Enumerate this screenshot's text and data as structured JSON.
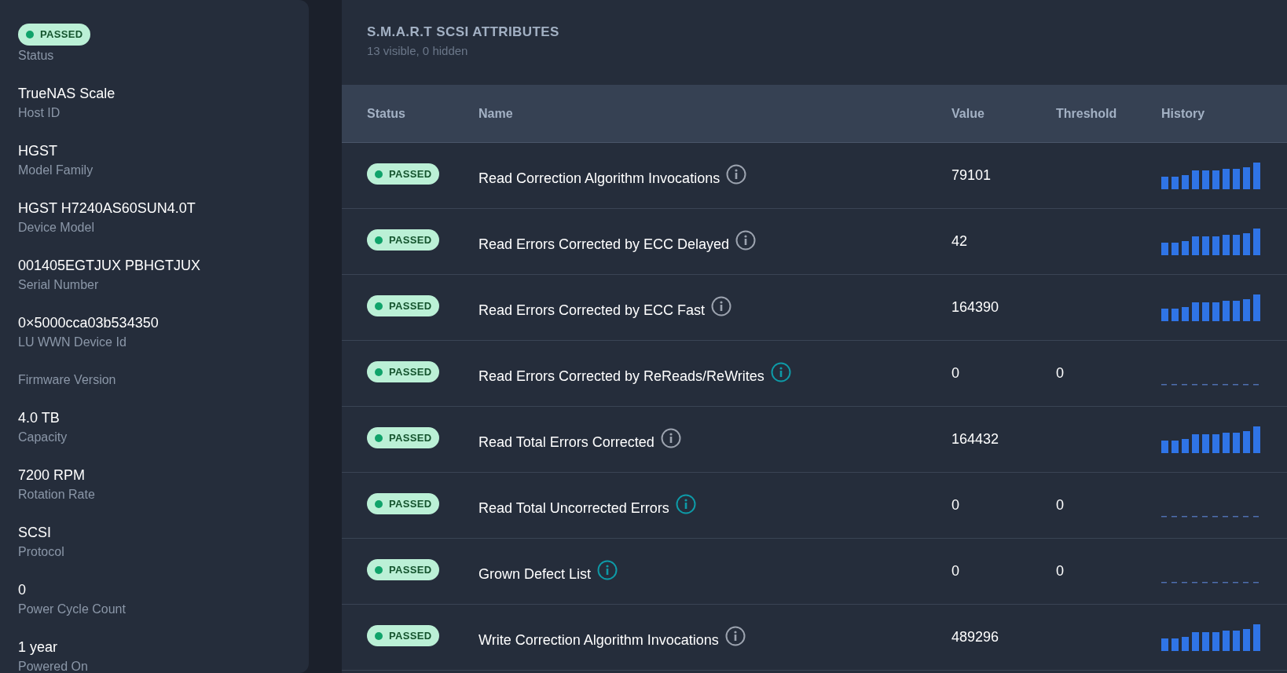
{
  "sidebar": {
    "items": [
      {
        "kind": "badge",
        "value": "PASSED",
        "label": "Status"
      },
      {
        "kind": "text",
        "value": "TrueNAS Scale",
        "label": "Host ID"
      },
      {
        "kind": "text",
        "value": "HGST",
        "label": "Model Family"
      },
      {
        "kind": "text",
        "value": "HGST H7240AS60SUN4.0T",
        "label": "Device Model"
      },
      {
        "kind": "text",
        "value": "001405EGTJUX PBHGTJUX",
        "label": "Serial Number"
      },
      {
        "kind": "text",
        "value": "0×5000cca03b534350",
        "label": "LU WWN Device Id"
      },
      {
        "kind": "text",
        "label": "Firmware Version"
      },
      {
        "kind": "text",
        "value": "4.0 TB",
        "label": "Capacity"
      },
      {
        "kind": "text",
        "value": "7200 RPM",
        "label": "Rotation Rate"
      },
      {
        "kind": "text",
        "value": "SCSI",
        "label": "Protocol"
      },
      {
        "kind": "text",
        "value": "0",
        "label": "Power Cycle Count"
      },
      {
        "kind": "text",
        "value": "1 year",
        "label": "Powered On"
      }
    ]
  },
  "panel": {
    "title": "S.M.A.R.T SCSI ATTRIBUTES",
    "subtitle": "13 visible, 0 hidden"
  },
  "table": {
    "columns": [
      "Status",
      "Name",
      "Value",
      "Threshold",
      "History"
    ],
    "rows": [
      {
        "status": "PASSED",
        "name": "Read Correction Algorithm Invocations",
        "color": "#9ca3af",
        "value": "79101",
        "kind": "bars"
      },
      {
        "status": "PASSED",
        "name": "Read Errors Corrected by ECC Delayed",
        "color": "#9ca3af",
        "value": "42",
        "kind": "bars"
      },
      {
        "status": "PASSED",
        "name": "Read Errors Corrected by ECC Fast",
        "color": "#9ca3af",
        "value": "164390",
        "kind": "bars"
      },
      {
        "status": "PASSED",
        "name": "Read Errors Corrected by ReReads/ReWrites",
        "color": "#0e9aa7",
        "value": "0",
        "threshold": "0",
        "kind": "flat"
      },
      {
        "status": "PASSED",
        "name": "Read Total Errors Corrected",
        "color": "#9ca3af",
        "value": "164432",
        "kind": "bars"
      },
      {
        "status": "PASSED",
        "name": "Read Total Uncorrected Errors",
        "color": "#0e9aa7",
        "value": "0",
        "threshold": "0",
        "kind": "flat"
      },
      {
        "status": "PASSED",
        "name": "Grown Defect List",
        "color": "#0e9aa7",
        "value": "0",
        "threshold": "0",
        "kind": "flat"
      },
      {
        "status": "PASSED",
        "name": "Write Correction Algorithm Invocations",
        "color": "#9ca3af",
        "value": "489296",
        "kind": "bars"
      }
    ]
  }
}
